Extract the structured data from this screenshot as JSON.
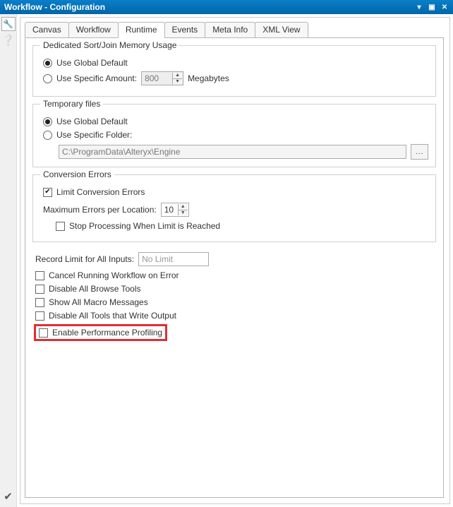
{
  "window": {
    "title": "Workflow - Configuration"
  },
  "tabs": {
    "canvas": "Canvas",
    "workflow": "Workflow",
    "runtime": "Runtime",
    "events": "Events",
    "metainfo": "Meta Info",
    "xmlview": "XML View"
  },
  "memory": {
    "legend": "Dedicated Sort/Join Memory Usage",
    "global_default": "Use Global Default",
    "specific_amount": "Use Specific Amount:",
    "amount_value": "800",
    "unit": "Megabytes"
  },
  "temp": {
    "legend": "Temporary files",
    "global_default": "Use Global Default",
    "specific_folder": "Use Specific Folder:",
    "path": "C:\\ProgramData\\Alteryx\\Engine",
    "browse": "..."
  },
  "conv": {
    "legend": "Conversion Errors",
    "limit": "Limit Conversion Errors",
    "max_label": "Maximum Errors per Location:",
    "max_value": "10",
    "stop": "Stop Processing When Limit is Reached"
  },
  "record": {
    "label": "Record Limit for All Inputs:",
    "placeholder": "No Limit"
  },
  "opts": {
    "cancel": "Cancel Running Workflow on Error",
    "disable_browse": "Disable All Browse Tools",
    "show_macro": "Show All Macro Messages",
    "disable_write": "Disable All Tools that Write Output",
    "profiling": "Enable Performance Profiling"
  }
}
